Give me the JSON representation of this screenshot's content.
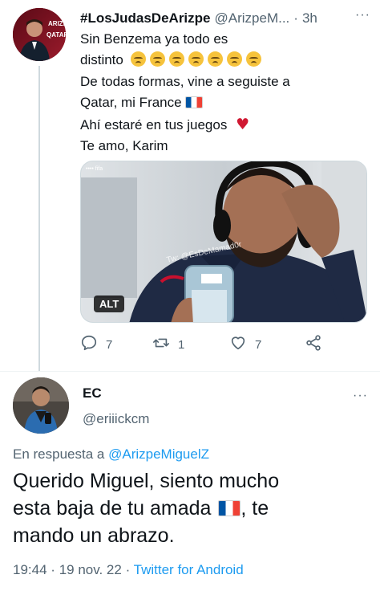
{
  "parent_tweet": {
    "display_name": "#LosJudasDeArizpe",
    "handle": "@ArizpeM...",
    "separator": "·",
    "time": "3h",
    "more_icon": "more-dots-icon",
    "lines": {
      "l1": "Sin Benzema ya todo es",
      "l2": "distinto",
      "l3": "De todas formas, vine a seguiste a",
      "l4": "Qatar, mi France",
      "l5": "Ahí estaré en tus juegos",
      "l6": "Te amo, Karim"
    },
    "media": {
      "alt_badge": "ALT",
      "watermark": "Tw: @EsDeMamad0r"
    },
    "actions": {
      "replies": "7",
      "retweets": "1",
      "likes": "7"
    },
    "avatar_text": {
      "top": "ARIZP",
      "bottom": "QATAR"
    }
  },
  "reply_tweet": {
    "display_name": "EC",
    "handle": "@eriiickcm",
    "replying_prefix": "En respuesta a",
    "replying_to": "@ArizpeMiguelZ",
    "lines": {
      "l1": "Querido Miguel, siento mucho",
      "l2": "esta baja de tu amada",
      "l2_tail": ", te",
      "l3": "mando un abrazo."
    },
    "time": "19:44",
    "dot1": "·",
    "date": "19 nov. 22",
    "dot2": "·",
    "source": "Twitter for Android"
  },
  "colors": {
    "link": "#1d9bf0",
    "secondary_text": "#536471",
    "heart": "#d01832"
  }
}
